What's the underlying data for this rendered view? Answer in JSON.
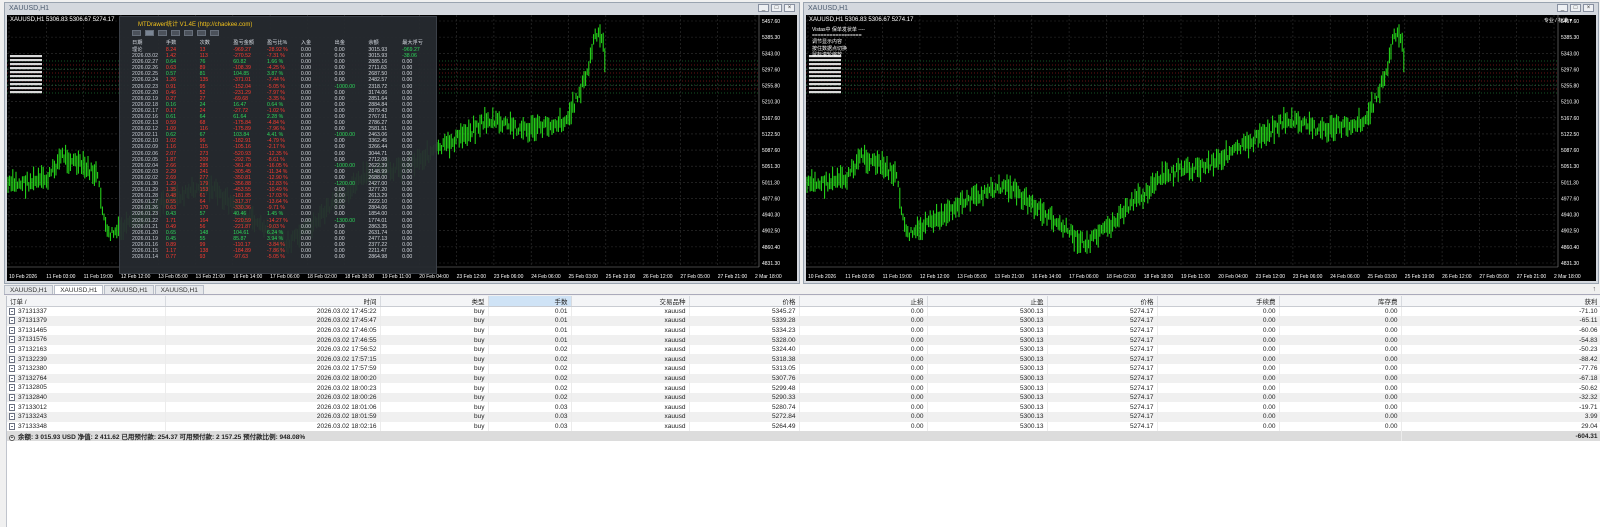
{
  "windows": {
    "left": {
      "title": "XAUUSD,H1",
      "chart_symbol": "XAUUSD,H1  5306.83 5306.67 5274.17"
    },
    "right": {
      "title": "XAUUSD,H1",
      "chart_symbol": "XAUUSD,H1  5306.83 5306.67 5274.17",
      "corner_label": "专业 / 标准 ▾"
    }
  },
  "window_buttons": [
    "_",
    "□",
    "×"
  ],
  "price_axis": [
    "5457.60",
    "5385.30",
    "5343.00",
    "5297.60",
    "5255.80",
    "5210.30",
    "5167.60",
    "5122.50",
    "5087.60",
    "5051.30",
    "5011.30",
    "4977.60",
    "4940.30",
    "4902.50",
    "4860.40",
    "4831.30"
  ],
  "time_axis": [
    "10 Feb 2026",
    "11 Feb 03:00",
    "11 Feb 19:00",
    "12 Feb 12:00",
    "13 Feb 05:00",
    "13 Feb 21:00",
    "16 Feb 14:00",
    "17 Feb 06:00",
    "18 Feb 02:00",
    "18 Feb 18:00",
    "19 Feb 11:00",
    "20 Feb 04:00",
    "23 Feb 12:00",
    "23 Feb 06:00",
    "24 Feb 06:00",
    "25 Feb 03:00",
    "25 Feb 19:00",
    "26 Feb 12:00",
    "27 Feb 05:00",
    "27 Feb 21:00",
    "2 Mar 18:00"
  ],
  "mtdrawer": {
    "title": "MTDrawer统计 V1.4E  (http://chaokee.com)",
    "headers": [
      "日期",
      "手数",
      "次数",
      "盈亏金额",
      "盈亏比%",
      "入金",
      "出金",
      "余额",
      "最大浮亏"
    ],
    "total_row": [
      "理论",
      "8.24",
      "13",
      "-969.27",
      "-28.92 %",
      "0.00",
      "0.00",
      "3015.93",
      "-969.27"
    ],
    "rows": [
      [
        "2026.03.02",
        "1.42",
        "113",
        "-270.52",
        "-7.31 %",
        "0.00",
        "0.00",
        "3015.93",
        "-38.06"
      ],
      [
        "2026.02.27",
        "0.64",
        "76",
        "60.82",
        "1.66 %",
        "0.00",
        "0.00",
        "2885.16",
        "0.00"
      ],
      [
        "2026.02.26",
        "0.63",
        "89",
        "-108.39",
        "-4.25 %",
        "0.00",
        "0.00",
        "2711.63",
        "0.00"
      ],
      [
        "2026.02.25",
        "0.57",
        "81",
        "104.85",
        "3.87 %",
        "0.00",
        "0.00",
        "2687.50",
        "0.00"
      ],
      [
        "2026.02.24",
        "1.26",
        "135",
        "-371.01",
        "-7.44 %",
        "0.00",
        "0.00",
        "2482.57",
        "0.00"
      ],
      [
        "2026.02.23",
        "0.91",
        "95",
        "-152.04",
        "-5.05 %",
        "0.00",
        "-1000.00",
        "2318.72",
        "0.00"
      ],
      [
        "2026.02.20",
        "0.46",
        "52",
        "-231.29",
        "-7.97 %",
        "0.00",
        "0.00",
        "3174.06",
        "0.00"
      ],
      [
        "2026.02.19",
        "0.27",
        "27",
        "-69.68",
        "-3.35 %",
        "0.00",
        "0.00",
        "2851.64",
        "0.00"
      ],
      [
        "2026.02.18",
        "0.16",
        "24",
        "16.47",
        "0.64 %",
        "0.00",
        "0.00",
        "2884.84",
        "0.00"
      ],
      [
        "2026.02.17",
        "0.17",
        "24",
        "-27.72",
        "-1.02 %",
        "0.00",
        "0.00",
        "2879.43",
        "0.00"
      ],
      [
        "2026.02.16",
        "0.61",
        "64",
        "61.64",
        "2.28 %",
        "0.00",
        "0.00",
        "2767.91",
        "0.00"
      ],
      [
        "2026.02.13",
        "0.59",
        "68",
        "-175.84",
        "-4.84 %",
        "0.00",
        "0.00",
        "2786.27",
        "0.00"
      ],
      [
        "2026.02.12",
        "1.09",
        "116",
        "-175.89",
        "-7.96 %",
        "0.00",
        "0.00",
        "2581.51",
        "0.00"
      ],
      [
        "2026.02.11",
        "0.62",
        "67",
        "103.84",
        "4.41 %",
        "0.00",
        "-1000.00",
        "2463.06",
        "0.00"
      ],
      [
        "2026.02.10",
        "1.02",
        "96",
        "-182.91",
        "-4.79 %",
        "0.00",
        "0.00",
        "3362.45",
        "0.00"
      ],
      [
        "2026.02.09",
        "1.16",
        "115",
        "-105.16",
        "-2.17 %",
        "0.00",
        "0.00",
        "3266.44",
        "0.00"
      ],
      [
        "2026.02.06",
        "2.07",
        "273",
        "-520.93",
        "-12.35 %",
        "0.00",
        "0.00",
        "3044.71",
        "0.00"
      ],
      [
        "2026.02.05",
        "1.87",
        "209",
        "-292.75",
        "-8.61 %",
        "0.00",
        "0.00",
        "2712.08",
        "0.00"
      ],
      [
        "2026.02.04",
        "2.66",
        "285",
        "-361.40",
        "-16.05 %",
        "0.00",
        "-1000.00",
        "2622.39",
        "0.00"
      ],
      [
        "2026.02.03",
        "2.29",
        "241",
        "-305.45",
        "-11.34 %",
        "0.00",
        "0.00",
        "2148.99",
        "0.00"
      ],
      [
        "2026.02.02",
        "2.69",
        "277",
        "-350.81",
        "-12.90 %",
        "0.00",
        "0.00",
        "2688.00",
        "0.00"
      ],
      [
        "2026.01.30",
        "1.29",
        "179",
        "-356.88",
        "-12.83 %",
        "0.00",
        "-1200.00",
        "2427.00",
        "0.00"
      ],
      [
        "2026.01.29",
        "1.35",
        "153",
        "-453.55",
        "-10.49 %",
        "0.00",
        "0.00",
        "3277.20",
        "0.00"
      ],
      [
        "2026.01.28",
        "0.48",
        "61",
        "-181.85",
        "-17.03 %",
        "0.00",
        "0.00",
        "2613.29",
        "0.00"
      ],
      [
        "2026.01.27",
        "0.55",
        "64",
        "-317.37",
        "-13.64 %",
        "0.00",
        "0.00",
        "2222.10",
        "0.00"
      ],
      [
        "2026.01.26",
        "0.63",
        "170",
        "-330.36",
        "-9.71 %",
        "0.00",
        "0.00",
        "2804.06",
        "0.00"
      ],
      [
        "2026.01.23",
        "0.43",
        "57",
        "40.46",
        "1.45 %",
        "0.00",
        "0.00",
        "1854.00",
        "0.00"
      ],
      [
        "2026.01.22",
        "1.71",
        "164",
        "-220.59",
        "-14.27 %",
        "0.00",
        "-1300.00",
        "1774.01",
        "0.00"
      ],
      [
        "2026.01.21",
        "0.49",
        "56",
        "-221.87",
        "-9.03 %",
        "0.00",
        "0.00",
        "2863.35",
        "0.00"
      ],
      [
        "2026.01.20",
        "0.65",
        "148",
        "104.61",
        "6.24 %",
        "0.00",
        "0.00",
        "2631.74",
        "0.00"
      ],
      [
        "2026.01.19",
        "0.45",
        "55",
        "85.87",
        "3.94 %",
        "0.00",
        "0.00",
        "2477.13",
        "0.00"
      ],
      [
        "2026.01.16",
        "0.89",
        "99",
        "-110.17",
        "-3.84 %",
        "0.00",
        "0.00",
        "2377.22",
        "0.00"
      ],
      [
        "2026.01.15",
        "1.17",
        "138",
        "-184.89",
        "-7.86 %",
        "0.00",
        "0.00",
        "2211.47",
        "0.00"
      ],
      [
        "2026.01.14",
        "0.77",
        "93",
        "-97.63",
        "-5.05 %",
        "0.00",
        "0.00",
        "2864.98",
        "0.00"
      ]
    ]
  },
  "info_box": [
    "Vistas中 保单发状单 ---- ",
    "=================",
    "  调节显示内容",
    "  按住数据点切换",
    "  鼠标滚轮缩放"
  ],
  "tabs": [
    {
      "label": "XAUUSD,H1",
      "active": false
    },
    {
      "label": "XAUUSD,H1",
      "active": true
    },
    {
      "label": "XAUUSD,H1",
      "active": false
    },
    {
      "label": "XAUUSD,H1",
      "active": false
    }
  ],
  "trade_table": {
    "headers": [
      "订单 /",
      "时间",
      "类型",
      "手数",
      "交易品种",
      "价格",
      "止损",
      "止盈",
      "价格",
      "手续费",
      "库存费",
      "获利"
    ],
    "sorted_column": 3,
    "rows": [
      [
        "37131337",
        "2026.03.02 17:45:22",
        "buy",
        "0.01",
        "xauusd",
        "5345.27",
        "0.00",
        "5300.13",
        "5274.17",
        "0.00",
        "0.00",
        "-71.10"
      ],
      [
        "37131379",
        "2026.03.02 17:45:47",
        "buy",
        "0.01",
        "xauusd",
        "5339.28",
        "0.00",
        "5300.13",
        "5274.17",
        "0.00",
        "0.00",
        "-65.11"
      ],
      [
        "37131465",
        "2026.03.02 17:46:05",
        "buy",
        "0.01",
        "xauusd",
        "5334.23",
        "0.00",
        "5300.13",
        "5274.17",
        "0.00",
        "0.00",
        "-60.06"
      ],
      [
        "37131576",
        "2026.03.02 17:46:55",
        "buy",
        "0.01",
        "xauusd",
        "5328.00",
        "0.00",
        "5300.13",
        "5274.17",
        "0.00",
        "0.00",
        "-54.83"
      ],
      [
        "37132163",
        "2026.03.02 17:56:52",
        "buy",
        "0.02",
        "xauusd",
        "5324.40",
        "0.00",
        "5300.13",
        "5274.17",
        "0.00",
        "0.00",
        "-50.23"
      ],
      [
        "37132239",
        "2026.03.02 17:57:15",
        "buy",
        "0.02",
        "xauusd",
        "5318.38",
        "0.00",
        "5300.13",
        "5274.17",
        "0.00",
        "0.00",
        "-88.42"
      ],
      [
        "37132380",
        "2026.03.02 17:57:59",
        "buy",
        "0.02",
        "xauusd",
        "5313.05",
        "0.00",
        "5300.13",
        "5274.17",
        "0.00",
        "0.00",
        "-77.76"
      ],
      [
        "37132764",
        "2026.03.02 18:00:20",
        "buy",
        "0.02",
        "xauusd",
        "5307.76",
        "0.00",
        "5300.13",
        "5274.17",
        "0.00",
        "0.00",
        "-67.18"
      ],
      [
        "37132805",
        "2026.03.02 18:00:23",
        "buy",
        "0.02",
        "xauusd",
        "5299.48",
        "0.00",
        "5300.13",
        "5274.17",
        "0.00",
        "0.00",
        "-50.62"
      ],
      [
        "37132840",
        "2026.03.02 18:00:26",
        "buy",
        "0.02",
        "xauusd",
        "5290.33",
        "0.00",
        "5300.13",
        "5274.17",
        "0.00",
        "0.00",
        "-32.32"
      ],
      [
        "37133012",
        "2026.03.02 18:01:06",
        "buy",
        "0.03",
        "xauusd",
        "5280.74",
        "0.00",
        "5300.13",
        "5274.17",
        "0.00",
        "0.00",
        "-19.71"
      ],
      [
        "37133243",
        "2026.03.02 18:01:59",
        "buy",
        "0.03",
        "xauusd",
        "5272.84",
        "0.00",
        "5300.13",
        "5274.17",
        "0.00",
        "0.00",
        "3.99"
      ],
      [
        "37133348",
        "2026.03.02 18:02:16",
        "buy",
        "0.03",
        "xauusd",
        "5264.49",
        "0.00",
        "5300.13",
        "5274.17",
        "0.00",
        "0.00",
        "29.04"
      ]
    ],
    "balance_text": "余额: 3 015.93 USD  净值: 2 411.62  已用预付款: 254.37  可用预付款: 2 157.25  预付款比例: 948.08%",
    "balance_profit": "-604.31"
  },
  "colors": {
    "candle": "#27e21b",
    "chart_bg": "#000000",
    "grid": "#3a3a3a",
    "profit_pos": "#2dd85a",
    "profit_neg": "#ff3b30",
    "overlay_bg": "#262a30"
  }
}
